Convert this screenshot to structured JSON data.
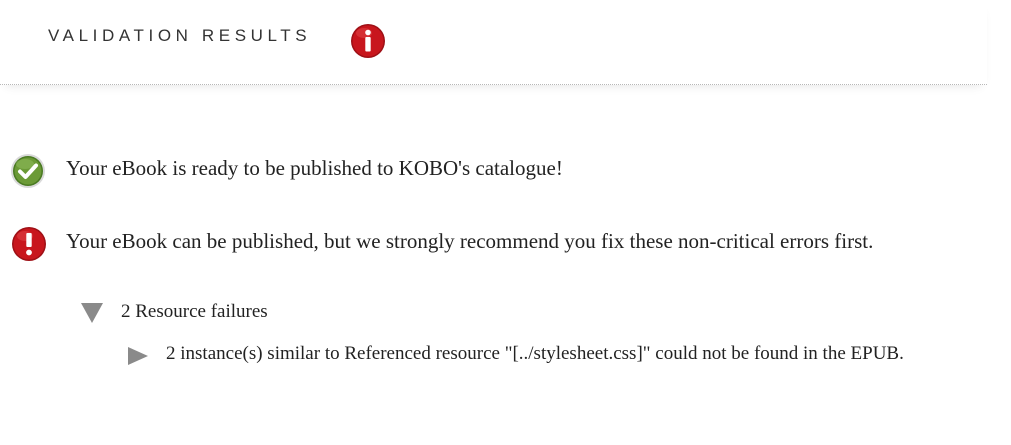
{
  "header": {
    "title": "VALIDATION RESULTS",
    "icon": "info-icon"
  },
  "results": {
    "success": {
      "icon": "check-circle-icon",
      "text": "Your eBook is ready to be published to KOBO's catalogue!"
    },
    "warning": {
      "icon": "exclamation-circle-icon",
      "text": "Your eBook can be published, but we strongly recommend you fix these non-critical errors first."
    }
  },
  "errors": {
    "group": {
      "icon": "triangle-down-icon",
      "label": "2 Resource failures",
      "expanded": true
    },
    "detail": {
      "icon": "triangle-right-icon",
      "text": "2 instance(s) similar to Referenced resource \"[../stylesheet.css]\" could not be found in the EPUB.",
      "expanded": false
    }
  },
  "colors": {
    "info_red": "#c8161d",
    "success_green": "#5a8a2a",
    "warning_red": "#c8161d",
    "triangle_gray": "#8a8a8a",
    "title_text": "#333333",
    "body_text": "#222222"
  }
}
